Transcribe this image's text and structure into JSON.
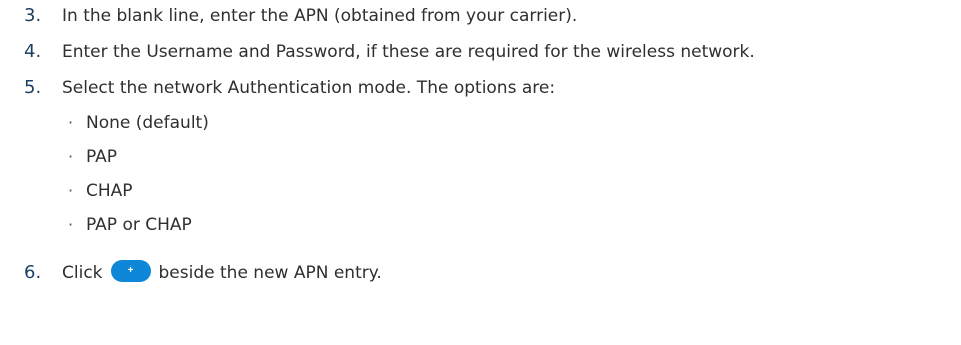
{
  "steps": [
    {
      "num": "3.",
      "text": "In the blank line, enter the APN (obtained from your carrier)."
    },
    {
      "num": "4.",
      "text": "Enter the Username and Password, if these are required for the wireless network."
    },
    {
      "num": "5.",
      "text": "Select the network Authentication mode. The options are:"
    }
  ],
  "options": [
    {
      "bullet": "·",
      "text": "None (default)"
    },
    {
      "bullet": "·",
      "text": "PAP"
    },
    {
      "bullet": "·",
      "text": "CHAP"
    },
    {
      "bullet": "·",
      "text": "PAP or CHAP"
    }
  ],
  "step6": {
    "num": "6.",
    "before": "Click",
    "button_glyph": "+",
    "after": "beside the new APN entry.",
    "button_color": "#0e87d9"
  }
}
